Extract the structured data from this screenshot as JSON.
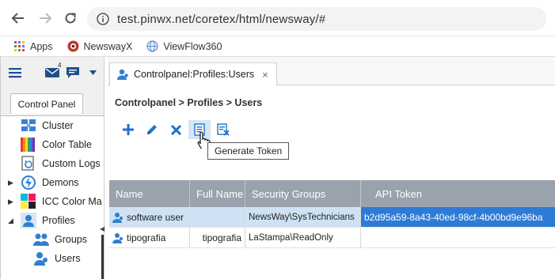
{
  "browser": {
    "url": "test.pinwx.net/coretex/html/newsway/#",
    "bookmarks": [
      {
        "label": "Apps",
        "icon": "apps-grid-icon"
      },
      {
        "label": "NewswayX",
        "icon": "newswayx-icon"
      },
      {
        "label": "ViewFlow360",
        "icon": "viewflow-globe-icon"
      }
    ]
  },
  "sidebar": {
    "mail_badge": "4",
    "panel_tab": "Control Panel",
    "items": [
      {
        "label": "Cluster"
      },
      {
        "label": "Color Table"
      },
      {
        "label": "Custom Logs"
      },
      {
        "label": "Demons"
      },
      {
        "label": "ICC Color Ma"
      },
      {
        "label": "Profiles"
      },
      {
        "label": "Groups"
      },
      {
        "label": "Users"
      }
    ]
  },
  "main": {
    "tab_label": "Controlpanel:Profiles:Users",
    "tab_close": "×",
    "breadcrumb": "Controlpanel > Profiles > Users",
    "tooltip": "Generate Token",
    "table": {
      "columns": [
        "Name",
        "Full Name",
        "Security Groups",
        "API Token"
      ],
      "rows": [
        {
          "name": "software user",
          "full_name": "",
          "groups": "NewsWay\\SysTechnicians",
          "token": "b2d95a59-8a43-40ed-98cf-4b00bd9e96ba"
        },
        {
          "name": "tipografia",
          "full_name": "tipografia",
          "groups": "LaStampa\\ReadOnly",
          "token": ""
        }
      ]
    }
  },
  "colors": {
    "accent": "#1f73c9",
    "header": "#9aa2ae",
    "selected_row": "#cfe2f3",
    "selected_token": "#2e7bd6"
  }
}
